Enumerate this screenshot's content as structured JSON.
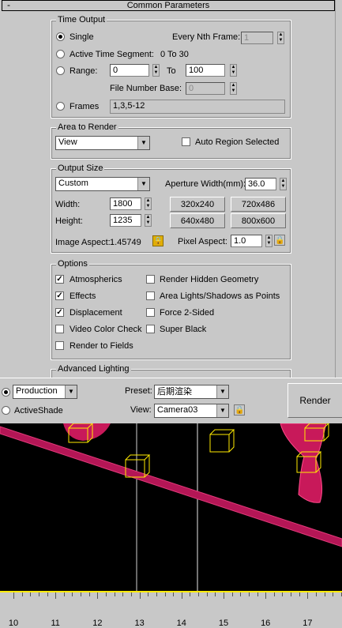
{
  "rollout": {
    "toggle": "-",
    "title": "Common Parameters"
  },
  "time_output": {
    "group_title": "Time Output",
    "single": "Single",
    "every_nth_label": "Every Nth Frame:",
    "every_nth_value": "1",
    "active_segment": "Active Time Segment:",
    "active_segment_value": "0 To 30",
    "range": "Range:",
    "range_from": "0",
    "range_to_label": "To",
    "range_to": "100",
    "file_number_base_label": "File Number Base:",
    "file_number_base_value": "0",
    "frames": "Frames",
    "frames_value": "1,3,5-12",
    "selected": "single"
  },
  "area_to_render": {
    "group_title": "Area to Render",
    "value": "View",
    "auto_region": "Auto Region Selected",
    "auto_region_checked": false
  },
  "output_size": {
    "group_title": "Output Size",
    "preset": "Custom",
    "aperture_label": "Aperture Width(mm):",
    "aperture_value": "36.0",
    "width_label": "Width:",
    "width_value": "1800",
    "height_label": "Height:",
    "height_value": "1235",
    "presets": [
      "320x240",
      "720x486",
      "640x480",
      "800x600"
    ],
    "image_aspect_label": "Image Aspect:",
    "image_aspect_value": "1.45749",
    "pixel_aspect_label": "Pixel Aspect:",
    "pixel_aspect_value": "1.0"
  },
  "options": {
    "group_title": "Options",
    "atmospherics": "Atmospherics",
    "effects": "Effects",
    "displacement": "Displacement",
    "video_color_check": "Video Color Check",
    "render_to_fields": "Render to Fields",
    "render_hidden": "Render Hidden Geometry",
    "area_lights": "Area Lights/Shadows as Points",
    "force_2_sided": "Force 2-Sided",
    "super_black": "Super Black"
  },
  "advanced_lighting": {
    "group_title": "Advanced Lighting"
  },
  "render_bar": {
    "mode": "Production",
    "activeshade": "ActiveShade",
    "preset_label": "Preset:",
    "preset_value": "后期渲染",
    "view_label": "View:",
    "view_value": "Camera03",
    "render_button": "Render"
  },
  "timeline": {
    "ticks": [
      "10",
      "11",
      "12",
      "13",
      "14",
      "15",
      "16",
      "17"
    ]
  },
  "colors": {
    "panel": "#c8c8c8",
    "viewport": "#000000",
    "geometry": "#c8195a",
    "helper": "#ffea00"
  }
}
